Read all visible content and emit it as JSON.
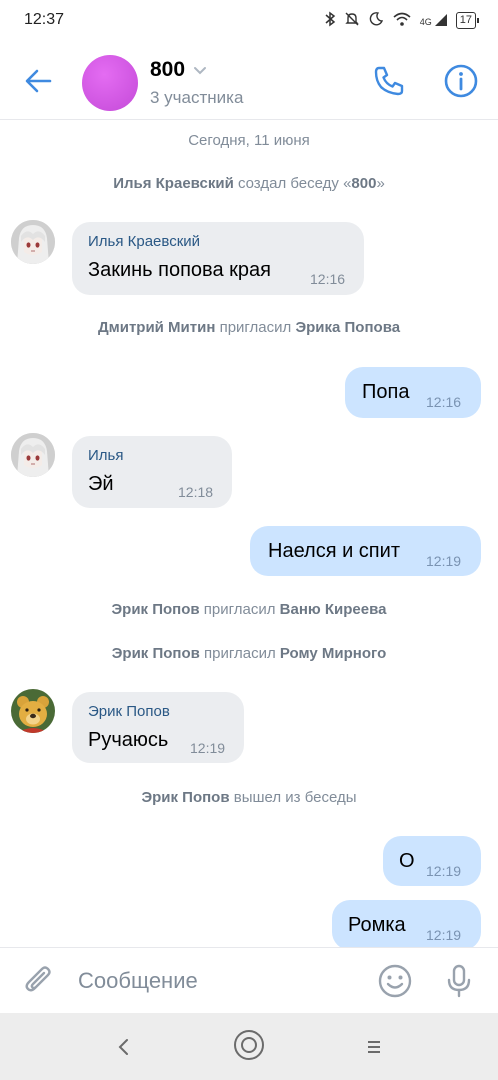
{
  "status_bar": {
    "time": "12:37",
    "battery": "17",
    "network": "4G"
  },
  "header": {
    "title": "800",
    "subtitle": "3 участника"
  },
  "chat": {
    "date": "Сегодня, 11 июня",
    "events": [
      {
        "name": "Илья Краевский",
        "text": " создал беседу «",
        "target": "800",
        "suffix": "»"
      },
      {
        "name": "Дмитрий Митин",
        "text": " пригласил ",
        "target": "Эрика Попова",
        "suffix": ""
      },
      {
        "name": "Эрик Попов",
        "text": " пригласил ",
        "target": "Ваню Киреева",
        "suffix": ""
      },
      {
        "name": "Эрик Попов",
        "text": " пригласил ",
        "target": "Рому Мирного",
        "suffix": ""
      },
      {
        "name": "Эрик Попов",
        "text": " вышел из беседы",
        "target": "",
        "suffix": ""
      }
    ],
    "messages": [
      {
        "sender": "Илья Краевский",
        "text": "Закинь попова края",
        "time": "12:16"
      },
      {
        "text": "Попа",
        "time": "12:16"
      },
      {
        "sender": "Илья",
        "text": "Эй",
        "time": "12:18"
      },
      {
        "text": "Наелся и спит",
        "time": "12:19"
      },
      {
        "sender": "Эрик Попов",
        "text": "Ручаюсь",
        "time": "12:19"
      },
      {
        "text": "О",
        "time": "12:19"
      },
      {
        "text": "Ромка",
        "time": "12:19"
      }
    ]
  },
  "composer": {
    "placeholder": "Сообщение"
  },
  "colors": {
    "accent": "#3f8ae0",
    "incoming_bubble": "#ebedf0",
    "outgoing_bubble": "#cce4ff",
    "group_avatar": "#d35be6",
    "sender_name": "#2a5885"
  }
}
